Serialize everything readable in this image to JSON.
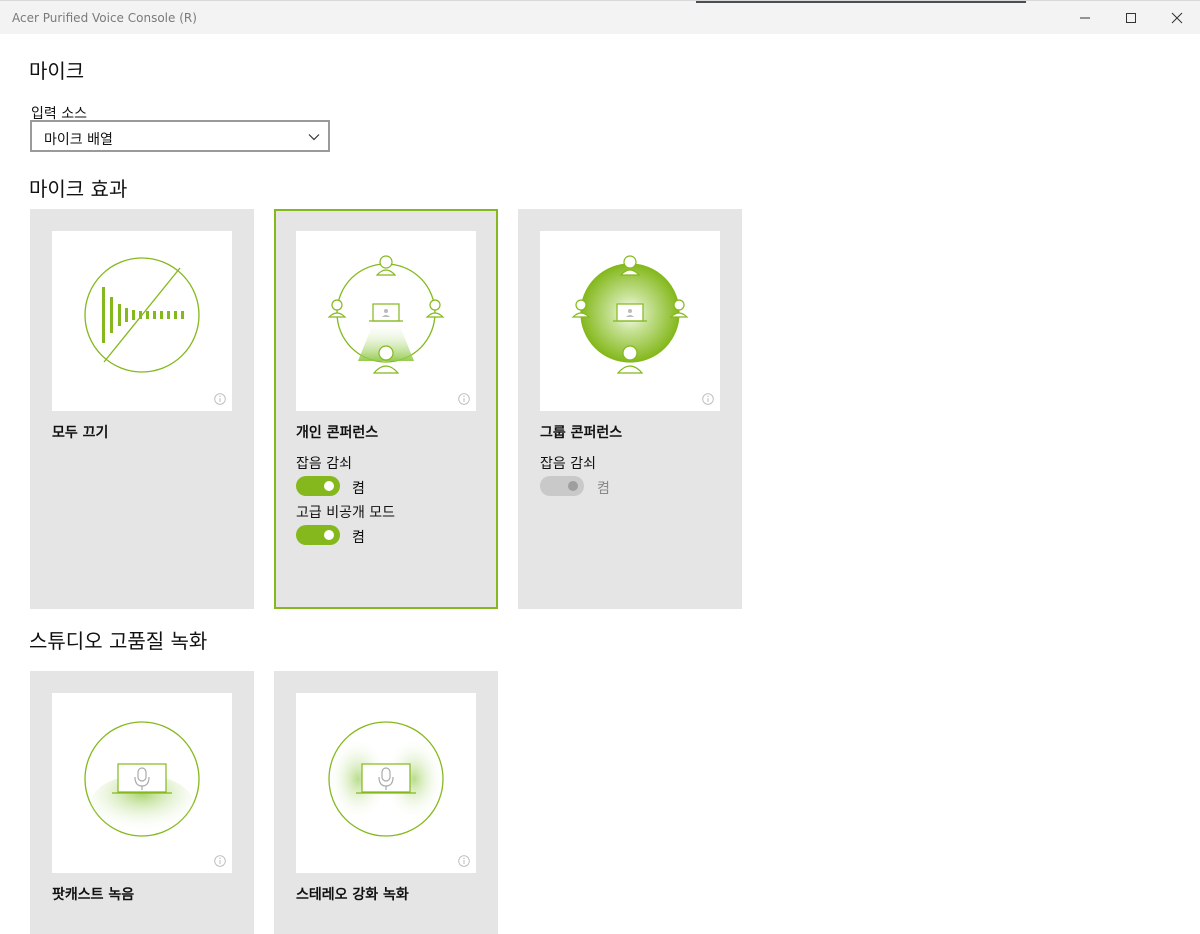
{
  "window": {
    "title": "Acer Purified Voice Console (R)"
  },
  "mic": {
    "heading": "마이크",
    "input_source_label": "입력 소스",
    "input_source_value": "마이크 배열"
  },
  "effects": {
    "heading": "마이크 효과",
    "cards": [
      {
        "title": "모두 끄기",
        "selected": false
      },
      {
        "title": "개인 콘퍼런스",
        "selected": true,
        "noise_label": "잡음 감쇠",
        "noise_state": "켬",
        "noise_enabled": true,
        "privacy_label": "고급 비공개 모드",
        "privacy_state": "켬",
        "privacy_enabled": true
      },
      {
        "title": "그룹 콘퍼런스",
        "selected": false,
        "noise_label": "잡음 감쇠",
        "noise_state": "켬",
        "noise_enabled": false
      }
    ]
  },
  "studio": {
    "heading": "스튜디오 고품질 녹화",
    "cards": [
      {
        "title": "팟캐스트 녹음"
      },
      {
        "title": "스테레오 강화 녹화"
      }
    ]
  },
  "colors": {
    "accent": "#84b81c",
    "card_bg": "#e5e5e5",
    "toggle_off": "#c9c9c9"
  }
}
